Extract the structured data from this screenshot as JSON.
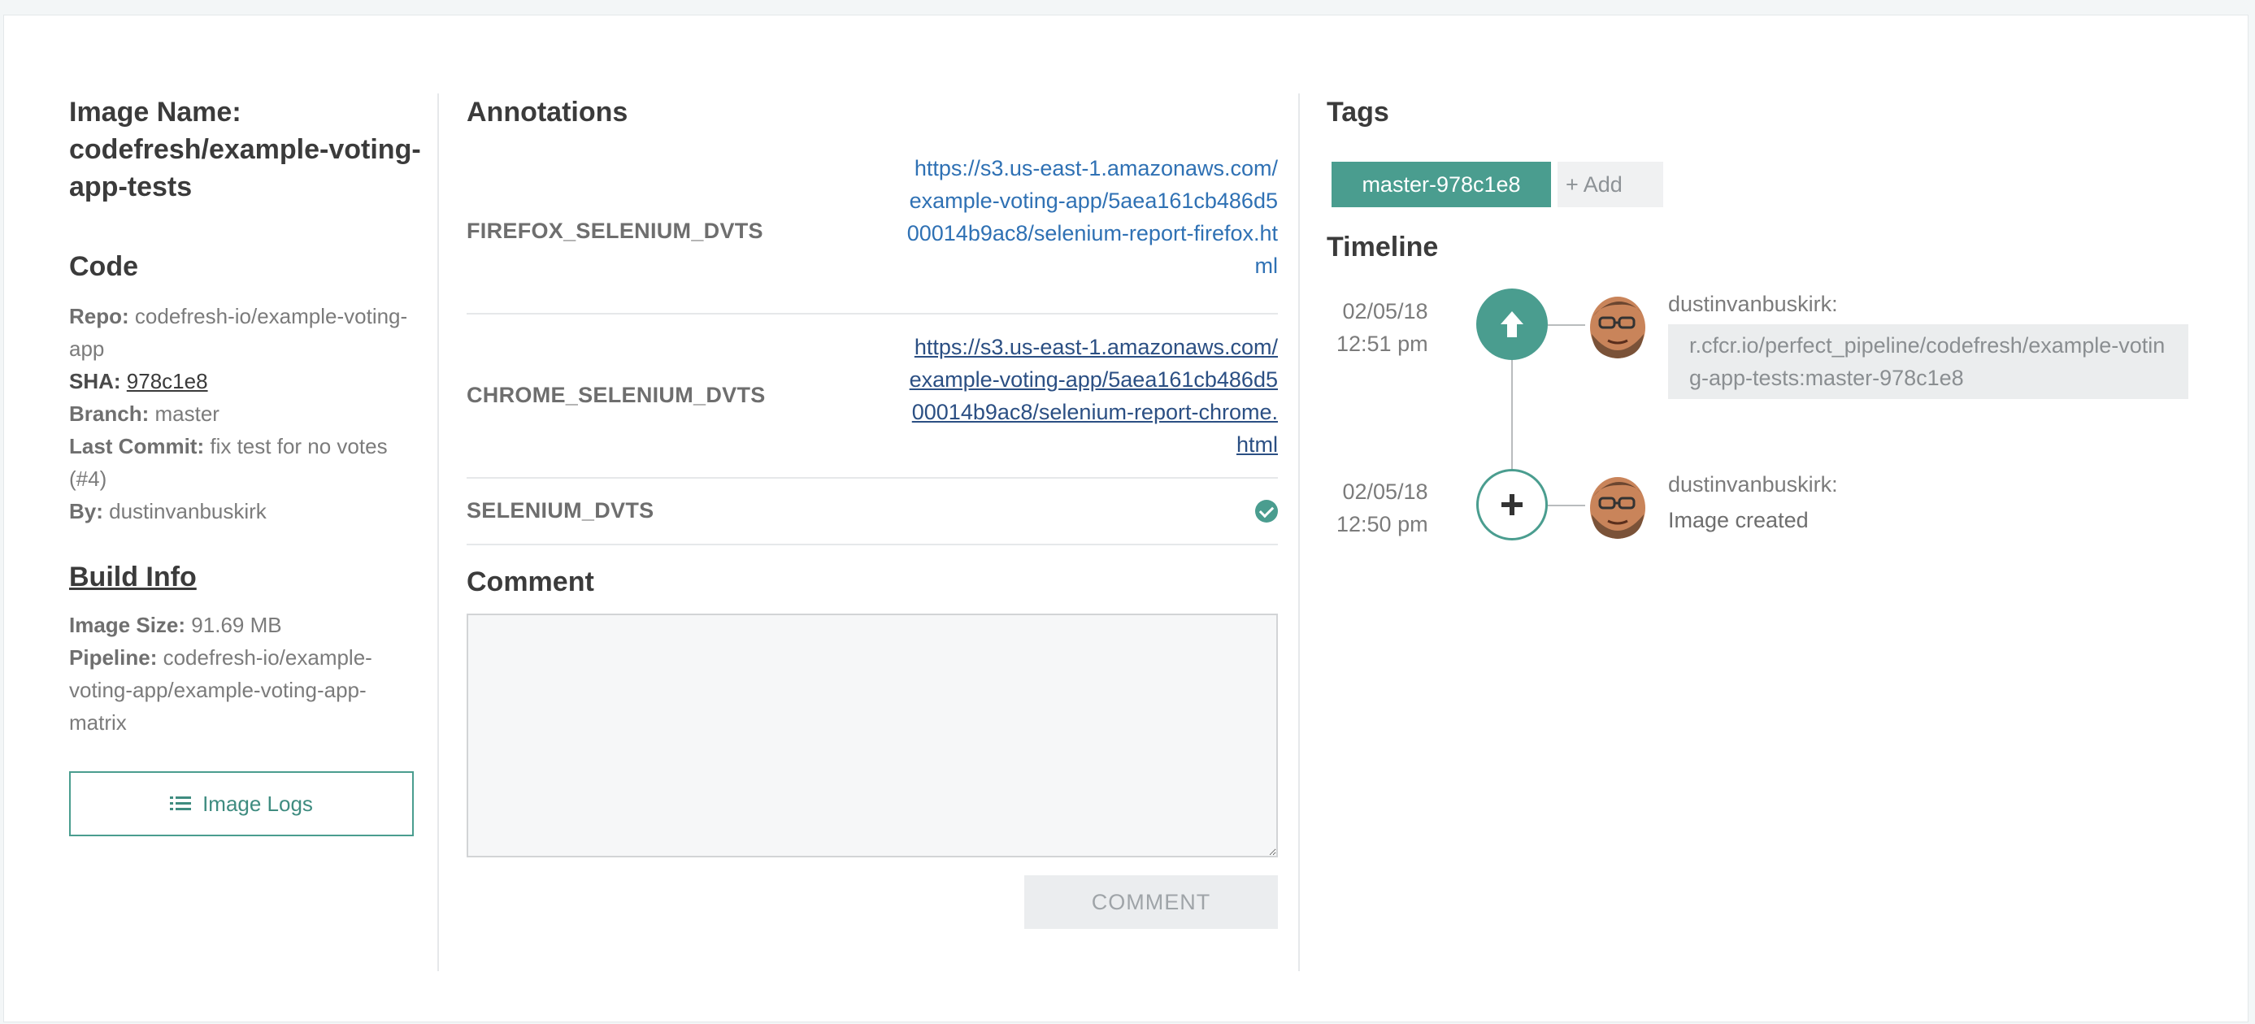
{
  "image": {
    "name_label": "Image Name:",
    "name_value": "codefresh/example-voting-app-tests"
  },
  "code": {
    "title": "Code",
    "repo_label": "Repo:",
    "repo_value": "codefresh-io/example-voting-app",
    "sha_label": "SHA:",
    "sha_value": "978c1e8",
    "branch_label": "Branch:",
    "branch_value": "master",
    "last_commit_label": "Last Commit:",
    "last_commit_value": "fix test for no votes (#4)",
    "by_label": "By:",
    "by_value": "dustinvanbuskirk"
  },
  "build": {
    "title": "Build Info",
    "size_label": "Image Size:",
    "size_value": "91.69 MB",
    "pipeline_label": "Pipeline:",
    "pipeline_value": "codefresh-io/example-voting-app/example-voting-app-matrix"
  },
  "logs_button": {
    "label": "Image Logs",
    "icon": "list-icon"
  },
  "annotations": {
    "title": "Annotations",
    "rows": [
      {
        "key": "FIREFOX_SELENIUM_DVTS",
        "value": "https://s3.us-east-1.amazonaws.com/example-voting-app/5aea161cb486d500014b9ac8/selenium-report-firefox.html"
      },
      {
        "key": "CHROME_SELENIUM_DVTS",
        "value": "https://s3.us-east-1.amazonaws.com/example-voting-app/5aea161cb486d500014b9ac8/selenium-report-chrome.html"
      },
      {
        "key": "SELENIUM_DVTS",
        "value_icon": "check-circle-icon"
      }
    ]
  },
  "comment": {
    "title": "Comment",
    "placeholder": "",
    "button": "COMMENT"
  },
  "tags": {
    "title": "Tags",
    "items": [
      "master-978c1e8"
    ],
    "add_label": "+ Add"
  },
  "timeline": {
    "title": "Timeline",
    "events": [
      {
        "date": "02/05/18",
        "time": "12:51 pm",
        "icon": "arrow-up-icon",
        "user": "dustinvanbuskirk:",
        "message": "r.cfcr.io/perfect_pipeline/codefresh/example-voting-app-tests:master-978c1e8"
      },
      {
        "date": "02/05/18",
        "time": "12:50 pm",
        "icon": "plus-icon",
        "user": "dustinvanbuskirk:",
        "message": "Image created"
      }
    ]
  },
  "colors": {
    "accent": "#4a9d8f",
    "link": "#2f71b4",
    "text": "#3d3d3d",
    "muted": "#7b7b7b"
  }
}
